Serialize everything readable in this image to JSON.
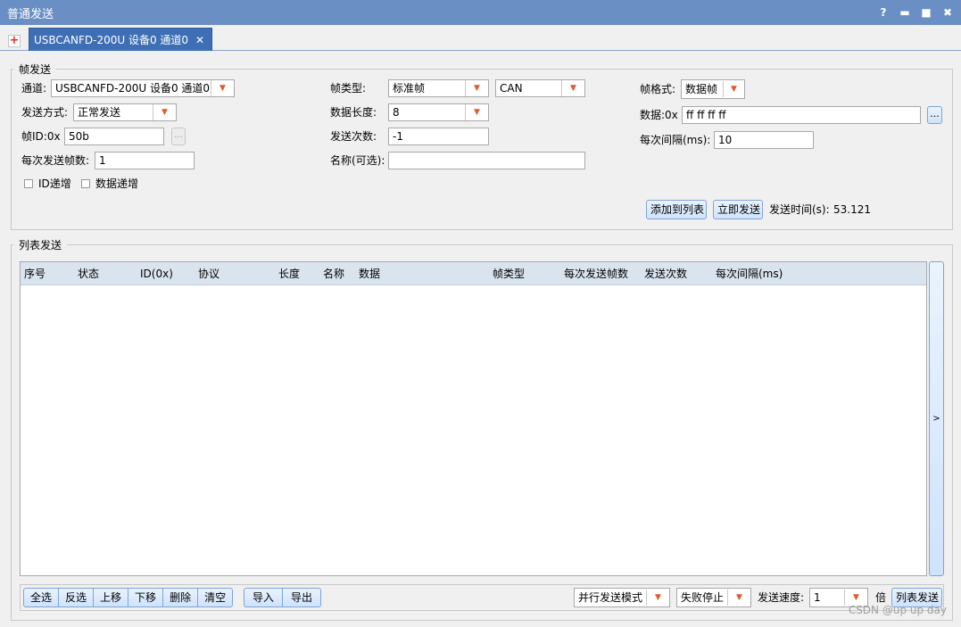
{
  "window": {
    "title": "普通发送",
    "help": "?",
    "minimize": "▬",
    "maximize": "■",
    "close": "✖"
  },
  "tabs": {
    "add": "+",
    "active_label": "USBCANFD-200U 设备0 通道0",
    "active_close": "✕"
  },
  "frame_send": {
    "legend": "帧发送",
    "channel_label": "通道:",
    "channel_value": "USBCANFD-200U 设备0 通道0",
    "send_mode_label": "发送方式:",
    "send_mode_value": "正常发送",
    "frame_id_label": "帧ID:0x",
    "frame_id_value": "50b",
    "frame_id_btn": "...",
    "frames_per_send_label": "每次发送帧数:",
    "frames_per_send_value": "1",
    "id_inc_label": "ID递增",
    "data_inc_label": "数据递增",
    "frame_type_label": "帧类型:",
    "frame_type_value": "标准帧",
    "protocol_value": "CAN",
    "data_len_label": "数据长度:",
    "data_len_value": "8",
    "send_count_label": "发送次数:",
    "send_count_value": "-1",
    "name_label": "名称(可选):",
    "name_value": "",
    "frame_format_label": "帧格式:",
    "frame_format_value": "数据帧",
    "data_label": "数据:0x",
    "data_value": "ff ff ff ff",
    "data_btn": "...",
    "interval_label": "每次间隔(ms):",
    "interval_value": "10",
    "add_to_list_btn": "添加到列表",
    "send_now_btn": "立即发送",
    "send_time_label": "发送时间(s):",
    "send_time_value": "53.121"
  },
  "list_send": {
    "legend": "列表发送",
    "columns": [
      "序号",
      "状态",
      "ID(0x)",
      "协议",
      "长度",
      "名称",
      "数据",
      "帧类型",
      "每次发送帧数",
      "发送次数",
      "每次间隔(ms)"
    ],
    "side_btn": ">",
    "buttons_group1": [
      "全选",
      "反选",
      "上移",
      "下移",
      "删除",
      "清空"
    ],
    "buttons_group2": [
      "导入",
      "导出"
    ],
    "mode_value": "并行发送模式",
    "fail_value": "失败停止",
    "speed_label": "发送速度:",
    "speed_value": "1",
    "speed_unit": "倍",
    "list_send_btn": "列表发送"
  },
  "watermark": "CSDN @up up day",
  "colors": {
    "titlebar": "#6a8fc4",
    "tab_active": "#3e6fb4",
    "arrow": "#e05a2c",
    "header_bg": "#dae4ef"
  }
}
